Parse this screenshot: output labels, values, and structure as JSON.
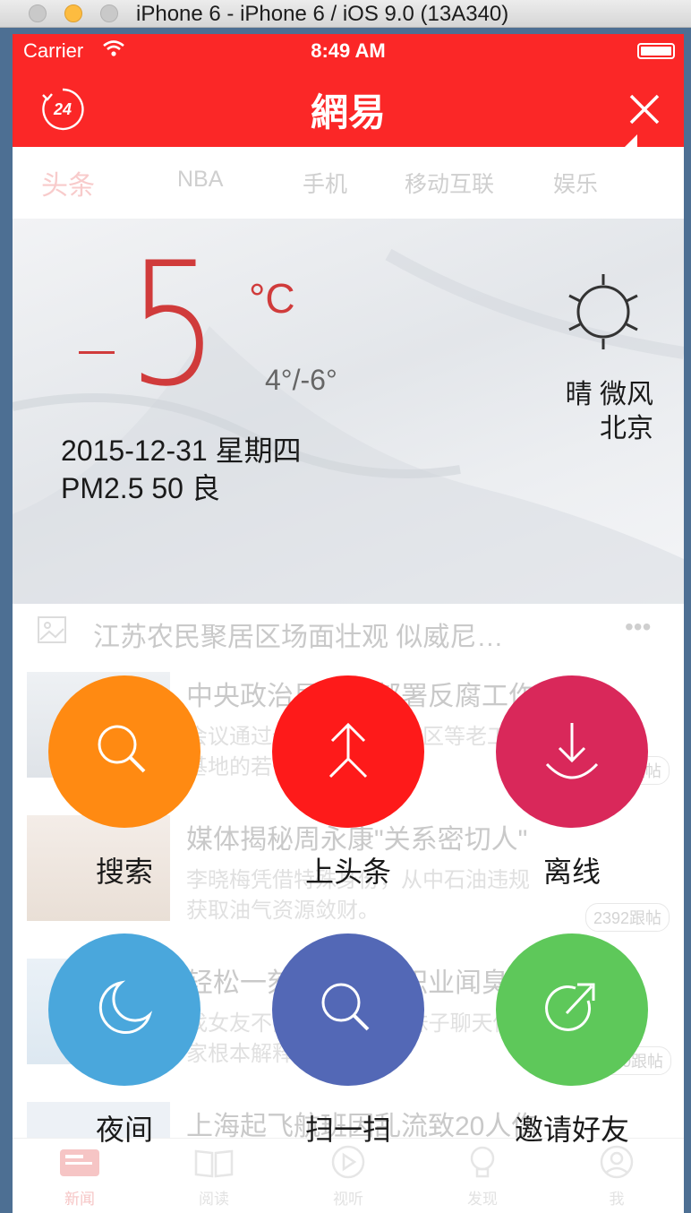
{
  "simulator": {
    "title": "iPhone 6 - iPhone 6 / iOS 9.0 (13A340)"
  },
  "status_bar": {
    "carrier": "Carrier",
    "time": "8:49 AM"
  },
  "header": {
    "logo": "網易",
    "news24_label": "24",
    "bg_color": "#fb2727"
  },
  "tabs": [
    "头条",
    "NBA",
    "手机",
    "移动互联",
    "娱乐"
  ],
  "weather": {
    "temperature": "5",
    "unit": "°C",
    "range": "4°/-6°",
    "date": "2015-12-31  星期四",
    "pm25": "PM2.5 50 良",
    "condition": "晴 微风",
    "city": "北京"
  },
  "feed": {
    "banner_title": "江苏农民聚居区场面壮观 似威尼…",
    "items": [
      {
        "title": "中央政治局会议部署反腐工作",
        "sub1": "会议通过全面振兴东北地区等老工业",
        "sub2": "基地的若干意见",
        "badge": "1468跟帖"
      },
      {
        "title": "媒体揭秘周永康\"关系密切人\"",
        "sub1": "李晓梅凭借特殊身份，从中石油违规",
        "sub2": "获取油气资源敛财。",
        "badge": "2392跟帖"
      },
      {
        "title": "轻松一刻语音版：职业闻臭师",
        "sub1": "找女友不能找太好的,跟妹子聊天你",
        "sub2": "家根本解释不清。",
        "badge": "100跟帖"
      },
      {
        "title": "上海起飞航班因乱流致20人伤",
        "sub1": "",
        "sub2": "",
        "badge": ""
      }
    ]
  },
  "actions": [
    {
      "label": "搜索",
      "color": "#ff8a12",
      "icon": "search-icon"
    },
    {
      "label": "上头条",
      "color": "#fe1a1a",
      "icon": "merge-arrow-icon"
    },
    {
      "label": "离线",
      "color": "#d9285a",
      "icon": "download-icon"
    },
    {
      "label": "夜间",
      "color": "#4aa7dc",
      "icon": "moon-icon"
    },
    {
      "label": "扫一扫",
      "color": "#5368b6",
      "icon": "scan-icon"
    },
    {
      "label": "邀请好友",
      "color": "#5ec85a",
      "icon": "share-icon"
    }
  ],
  "tabbar": [
    "新闻",
    "阅读",
    "视听",
    "发现",
    "我"
  ]
}
